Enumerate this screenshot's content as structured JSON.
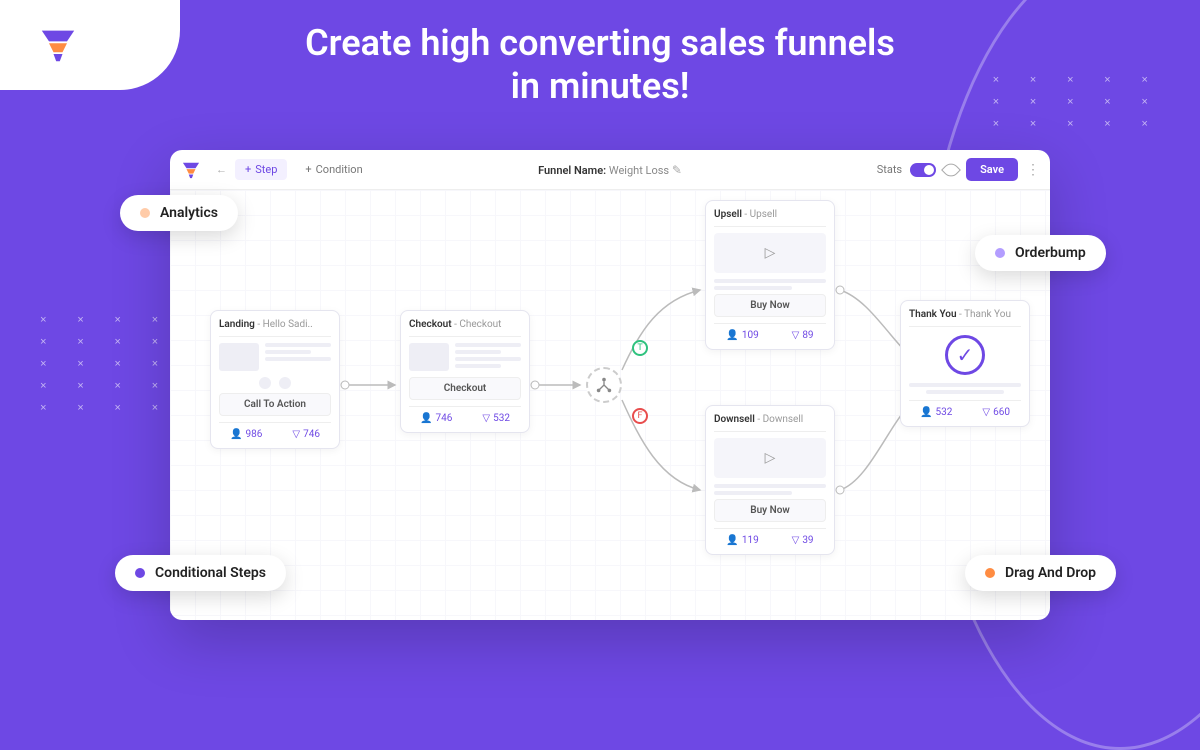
{
  "headline": "Create high converting sales funnels in minutes!",
  "toolbar": {
    "step": "Step",
    "condition": "Condition",
    "funnel_name_label": "Funnel Name:",
    "funnel_name_value": "Weight Loss",
    "stats": "Stats",
    "save": "Save"
  },
  "cards": {
    "landing": {
      "type": "Landing",
      "name": "Hello Sadi..",
      "cta": "Call To Action",
      "visits": 986,
      "conv": 746
    },
    "checkout": {
      "type": "Checkout",
      "name": "Checkout",
      "cta": "Checkout",
      "visits": 746,
      "conv": 532
    },
    "upsell": {
      "type": "Upsell",
      "name": "Upsell",
      "cta": "Buy Now",
      "visits": 109,
      "conv": 89
    },
    "downsell": {
      "type": "Downsell",
      "name": "Downsell",
      "cta": "Buy Now",
      "visits": 119,
      "conv": 39
    },
    "thankyou": {
      "type": "Thank You",
      "name": "Thank You",
      "visits": 532,
      "conv": 660
    }
  },
  "condition": {
    "true": "T",
    "false": "F"
  },
  "chips": {
    "analytics": "Analytics",
    "orderbump": "Orderbump",
    "conditional": "Conditional Steps",
    "dragdrop": "Drag And Drop"
  },
  "colors": {
    "purple": "#6e48e4",
    "orange": "#ff8c42",
    "peach": "#ffcba8",
    "lavender": "#b39dff"
  }
}
